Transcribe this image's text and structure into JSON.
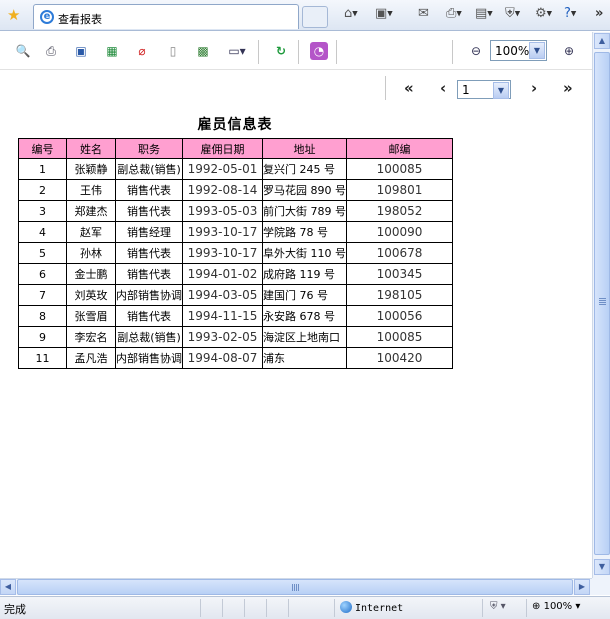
{
  "browser": {
    "tab_title": "查看报表",
    "chevron": "»",
    "icons": [
      "star-icon",
      "ie-icon",
      "home-icon",
      "feeds-icon",
      "mail-icon",
      "print-icon",
      "page-icon",
      "safety-icon",
      "tools-icon",
      "help-icon"
    ]
  },
  "toolbar": {
    "zoom_value": "100%",
    "icons": [
      "find-icon",
      "print-icon",
      "print-preview-icon",
      "excel-icon",
      "pdf-icon",
      "word-icon",
      "export-icon",
      "display-icon",
      "refresh-icon",
      "rss-icon",
      "zoom-out-icon",
      "zoom-in-icon"
    ]
  },
  "pager": {
    "first": "«",
    "prev": "‹",
    "page": "1",
    "next": "›",
    "last": "»"
  },
  "report": {
    "title": "雇员信息表",
    "header_color": "#ff9fd0",
    "columns": [
      "编号",
      "姓名",
      "职务",
      "雇佣日期",
      "地址",
      "邮编"
    ],
    "rows": [
      [
        "1",
        "张颖静",
        "副总裁(销售)",
        "1992-05-01",
        "复兴门 245 号",
        "100085"
      ],
      [
        "2",
        "王伟",
        "销售代表",
        "1992-08-14",
        "罗马花园 890 号",
        "109801"
      ],
      [
        "3",
        "郑建杰",
        "销售代表",
        "1993-05-03",
        "前门大街 789 号",
        "198052"
      ],
      [
        "4",
        "赵军",
        "销售经理",
        "1993-10-17",
        "学院路 78 号",
        "100090"
      ],
      [
        "5",
        "孙林",
        "销售代表",
        "1993-10-17",
        "阜外大街 110 号",
        "100678"
      ],
      [
        "6",
        "金士鹏",
        "销售代表",
        "1994-01-02",
        "成府路 119 号",
        "100345"
      ],
      [
        "7",
        "刘英玫",
        "内部销售协调",
        "1994-03-05",
        "建国门 76 号",
        "198105"
      ],
      [
        "8",
        "张雪眉",
        "销售代表",
        "1994-11-15",
        "永安路 678 号",
        "100056"
      ],
      [
        "9",
        "李宏名",
        "副总裁(销售)",
        "1993-02-05",
        "海淀区上地南口",
        "100085"
      ],
      [
        "11",
        "孟凡浩",
        "内部销售协调",
        "1994-08-07",
        "浦东",
        "100420"
      ]
    ]
  },
  "status": {
    "text": "完成",
    "zone": "Internet",
    "zoom": "100%"
  }
}
